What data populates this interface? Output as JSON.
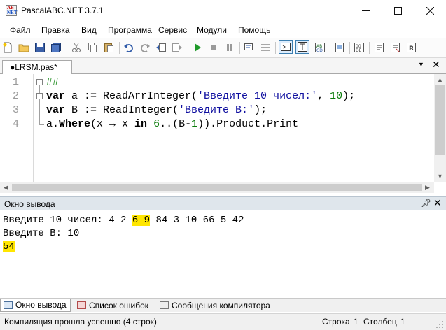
{
  "window": {
    "title": "PascalABC.NET 3.7.1"
  },
  "menu": [
    "Файл",
    "Правка",
    "Вид",
    "Программа",
    "Сервис",
    "Модули",
    "Помощь"
  ],
  "toolbar": {
    "icons": [
      "new-file-icon",
      "open-folder-icon",
      "save-icon",
      "save-all-icon",
      "cut-icon",
      "copy-icon",
      "paste-icon",
      "undo-icon",
      "redo-icon",
      "navigate-back-icon",
      "navigate-forward-icon",
      "run-icon",
      "stop-icon",
      "step-over-icon",
      "step-into-icon",
      "console-icon",
      "text-format-icon",
      "code-template-icon",
      "form-designer-icon",
      "code-completion-icon",
      "comment-icon",
      "uncomment-icon",
      "format-code-icon"
    ]
  },
  "tabs": {
    "file": "●LRSM.pas*"
  },
  "editor": {
    "line_numbers": [
      "1",
      "2",
      "3",
      "4"
    ],
    "lines": [
      {
        "comment": "##"
      },
      {
        "kw1": "var",
        "t1": " a := ReadArrInteger(",
        "str": "'Введите 10 чисел:'",
        "t2": ", ",
        "num": "10",
        "t3": ");"
      },
      {
        "kw1": "var",
        "t1": " B := ReadInteger(",
        "str": "'Введите B:'",
        "t3": ");"
      },
      {
        "t0": "a.",
        "kw1": "Where",
        "t1": "(x → x ",
        "kw2": "in",
        "t1b": " ",
        "num": "6",
        "t2": "..(B-",
        "num2": "1",
        "t3": ")).Product.Print"
      }
    ]
  },
  "output": {
    "title": "Окно вывода",
    "line1": {
      "before": "Введите 10 чисел: 4 2 ",
      "highlight": "6 9",
      "after": " 84 3 10 66 5 42"
    },
    "line2": "Введите B: 10",
    "line3": "54"
  },
  "bottom_tabs": [
    "Окно вывода",
    "Список ошибок",
    "Сообщения компилятора"
  ],
  "status": {
    "message": "Компиляция прошла успешно (4 строк)",
    "row_label": "Строка",
    "row": "1",
    "col_label": "Столбец",
    "col": "1"
  },
  "colors": {
    "highlight": "#ffe600",
    "string": "#1010a0",
    "number": "#0a7b0a",
    "output_header": "#dfe6ec"
  }
}
